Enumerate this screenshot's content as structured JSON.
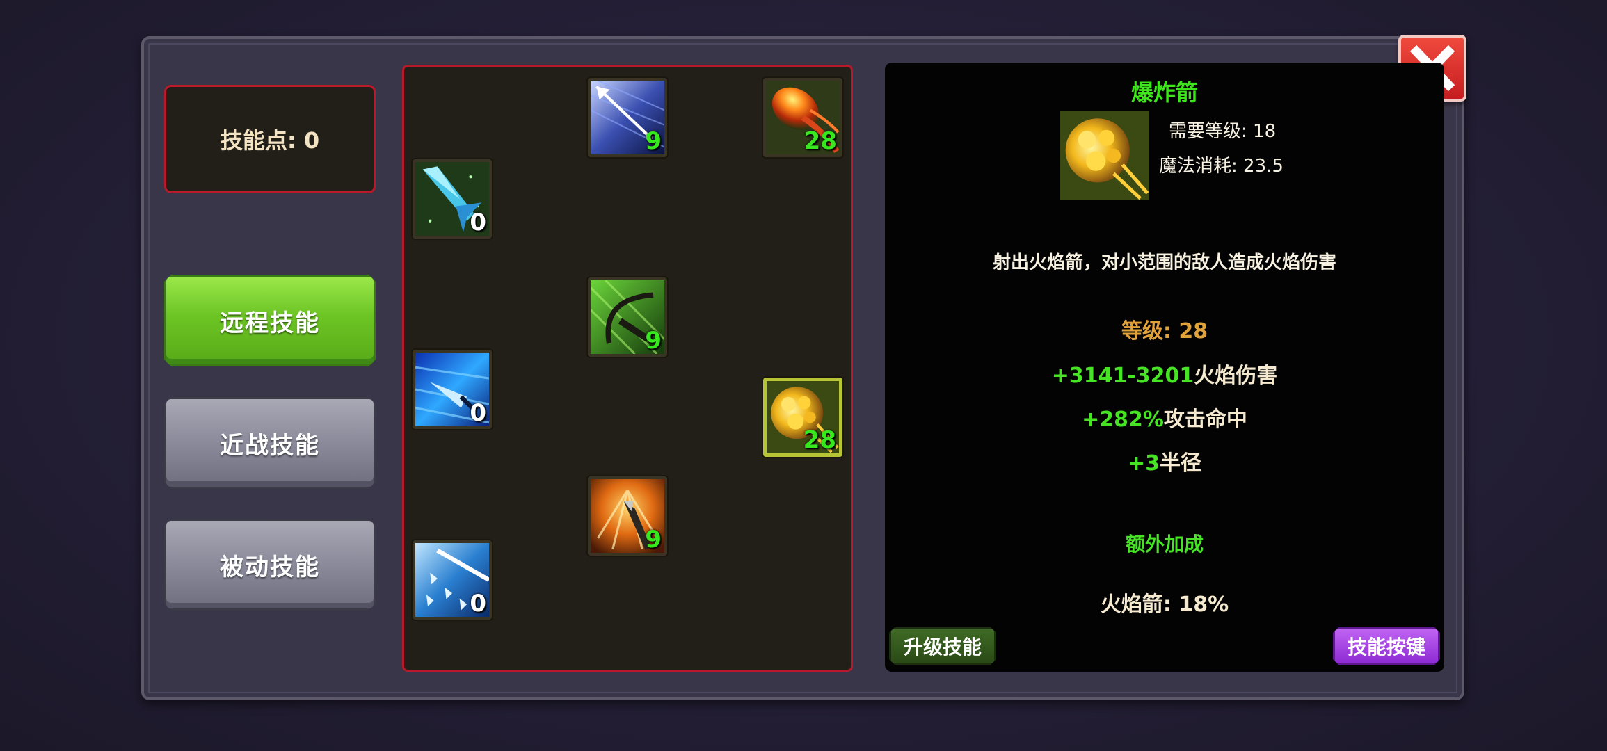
{
  "skill_points_label": "技能点: 0",
  "tabs": [
    {
      "label": "远程技能",
      "active": true
    },
    {
      "label": "近战技能",
      "active": false
    },
    {
      "label": "被动技能",
      "active": false
    }
  ],
  "skills": [
    {
      "id": "piercing-arrow",
      "level": "9",
      "level_color": "green",
      "icon": "piercing-arrow-icon"
    },
    {
      "id": "fire-arrow",
      "level": "28",
      "level_color": "green",
      "icon": "fire-arrow-icon"
    },
    {
      "id": "ice-arrow",
      "level": "0",
      "level_color": "white",
      "icon": "ice-arrow-icon"
    },
    {
      "id": "nature-bow",
      "level": "9",
      "level_color": "green",
      "icon": "nature-bow-icon"
    },
    {
      "id": "frost-shot",
      "level": "0",
      "level_color": "white",
      "icon": "frost-shot-icon"
    },
    {
      "id": "explosive-arrow",
      "level": "28",
      "level_color": "green",
      "icon": "explosive-arrow-icon",
      "selected": true
    },
    {
      "id": "flame-spear",
      "level": "9",
      "level_color": "green",
      "icon": "flame-spear-icon"
    },
    {
      "id": "ice-shards",
      "level": "0",
      "level_color": "white",
      "icon": "ice-shards-icon"
    }
  ],
  "detail": {
    "name": "爆炸箭",
    "required_level": "需要等级: 18",
    "mana_cost": "魔法消耗: 23.5",
    "description": "射出火焰箭，对小范围的敌人造成火焰伤害",
    "level_label": "等级:",
    "level_value": "28",
    "damage_value": "+3141-3201",
    "damage_label": "火焰伤害",
    "hit_value": "+282%",
    "hit_label": "攻击命中",
    "radius_value": "+3",
    "radius_label": "半径",
    "bonus_title": "额外加成",
    "bonus_line": "火焰箭: 18%"
  },
  "buttons": {
    "upgrade": "升级技能",
    "hotkey": "技能按键"
  },
  "colors": {
    "accent_green": "#46e425",
    "level_orange": "#e2a23a",
    "panel_border_red": "#b8192b",
    "close_red": "#e0342e",
    "hotkey_purple": "#a444e0"
  }
}
